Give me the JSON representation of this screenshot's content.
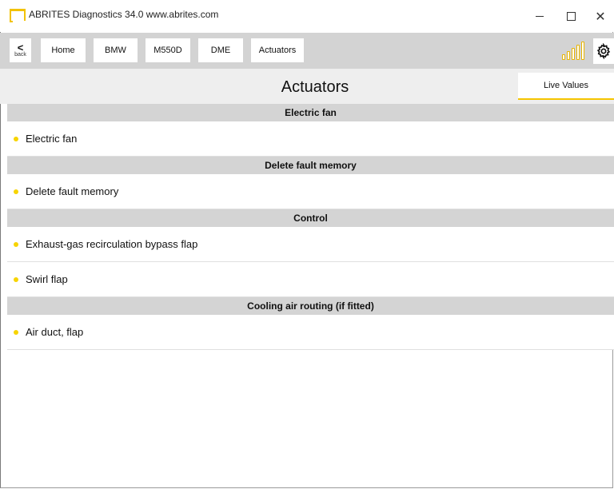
{
  "window": {
    "title": "ABRITES Diagnostics 34.0  www.abrites.com",
    "minimize_glyph": "",
    "maximize_glyph": "",
    "close_glyph": "✕"
  },
  "nav": {
    "back_label": "back",
    "back_glyph": "<",
    "crumbs": [
      "Home",
      "BMW",
      "M550D",
      "DME",
      "Actuators"
    ]
  },
  "header": {
    "title": "Actuators",
    "live_values_label": "Live Values"
  },
  "sections": [
    {
      "title": "Electric fan",
      "items": [
        "Electric fan"
      ]
    },
    {
      "title": "Delete fault memory",
      "items": [
        "Delete fault memory"
      ]
    },
    {
      "title": "Control",
      "items": [
        "Exhaust-gas recirculation bypass flap",
        "Swirl flap"
      ]
    },
    {
      "title": "Cooling air routing (if fitted)",
      "items": [
        "Air duct, flap"
      ]
    }
  ],
  "colors": {
    "accent": "#f5c400",
    "nav_bg": "#d3d3d3",
    "section_bg": "#d4d4d4"
  },
  "icons": {
    "app": "abrites-logo-icon",
    "signal": "signal-strength-icon",
    "settings": "gear-icon",
    "bullet": "bullet-dot-icon"
  }
}
